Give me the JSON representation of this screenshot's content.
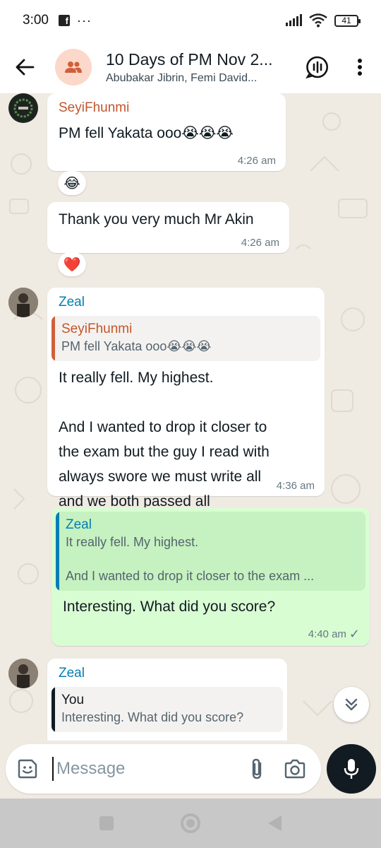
{
  "status_bar": {
    "time": "3:00",
    "notification_app": "f",
    "more_indicator": "···",
    "battery": "41"
  },
  "header": {
    "title": "10 Days of PM Nov 2...",
    "subtitle": "Abubakar Jibrin, Femi David..."
  },
  "messages": [
    {
      "sender": "SeyiFhunmi",
      "sender_color": "#c2562c",
      "text": "PM fell Yakata ooo😭😭😭",
      "time": "4:26 am",
      "reaction": "😂"
    },
    {
      "text": "Thank you very much Mr Akin",
      "time": "4:26 am",
      "reaction": "❤️"
    },
    {
      "sender": "Zeal",
      "sender_color": "#027eb5",
      "quote": {
        "name": "SeyiFhunmi",
        "text": "PM fell Yakata ooo😭😭😭"
      },
      "text_lines": [
        "It really fell. My highest.",
        "",
        "And I wanted to drop it closer to",
        "the exam but the guy I read with",
        "always swore we must write all",
        "and we both passed all"
      ],
      "time": "4:36 am"
    },
    {
      "outgoing": true,
      "quote": {
        "name": "Zeal",
        "line1": "It really fell. My highest.",
        "line2": "And I wanted to drop it closer to the exam ..."
      },
      "text": "Interesting. What did you score?",
      "time": "4:40 am",
      "status": "✓"
    },
    {
      "sender": "Zeal",
      "sender_color": "#027eb5",
      "quote": {
        "name": "You",
        "text": "Interesting. What did you score?"
      }
    }
  ],
  "composer": {
    "placeholder": "Message"
  },
  "colors": {
    "chat_background": "#efeae2",
    "outgoing_bubble": "#d9fdd3",
    "mic_button": "#111b21"
  }
}
